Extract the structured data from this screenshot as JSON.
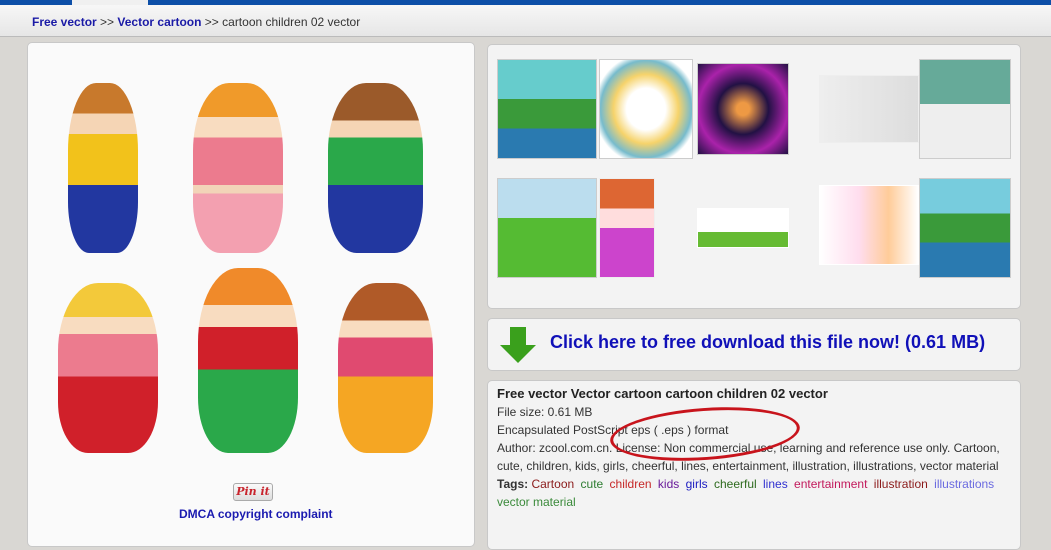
{
  "breadcrumb": {
    "items": [
      {
        "label": "Free vector"
      },
      {
        "label": "Vector cartoon"
      }
    ],
    "separator": ">>",
    "current": "cartoon children 02 vector"
  },
  "main_image": {
    "description_icon": "cartoon-children-image"
  },
  "pin_label": "Pin it",
  "dmca_label": "DMCA copyright complaint",
  "related_thumbnails": [
    "thumbnail-1",
    "thumbnail-2",
    "thumbnail-3",
    "thumbnail-4",
    "thumbnail-5",
    "thumbnail-6",
    "thumbnail-7",
    "thumbnail-8",
    "thumbnail-9",
    "thumbnail-10"
  ],
  "download": {
    "label": "Click here to free download this file now! (0.61 MB)",
    "icon": "download-arrow-icon",
    "color": "#3aa01c"
  },
  "info": {
    "title": "Free vector Vector cartoon cartoon children 02 vector",
    "file_size": "File size: 0.61 MB",
    "format": "Encapsulated PostScript eps ( .eps ) format",
    "author_license": "Author: zcool.com.cn. License: Non commercial use, learning and reference use only. Cartoon, cute, children, kids, girls, cheerful, lines, entertainment, illustration, illustrations, vector material",
    "tags_label": "Tags:",
    "tags": [
      {
        "label": "Cartoon",
        "color": "#8b1a1a"
      },
      {
        "label": "cute",
        "color": "#2e7d32"
      },
      {
        "label": "children",
        "color": "#c62828"
      },
      {
        "label": "kids",
        "color": "#6a1b9a"
      },
      {
        "label": "girls",
        "color": "#1a1ac0"
      },
      {
        "label": "cheerful",
        "color": "#2e6b1e"
      },
      {
        "label": "lines",
        "color": "#3030d0"
      },
      {
        "label": "entertainment",
        "color": "#c2185b"
      },
      {
        "label": "illustration",
        "color": "#8b1a1a"
      },
      {
        "label": "illustrations",
        "color": "#6a6ae0"
      },
      {
        "label": "vector material",
        "color": "#3a8a3a"
      }
    ]
  },
  "annotation_color": "#c8141c"
}
